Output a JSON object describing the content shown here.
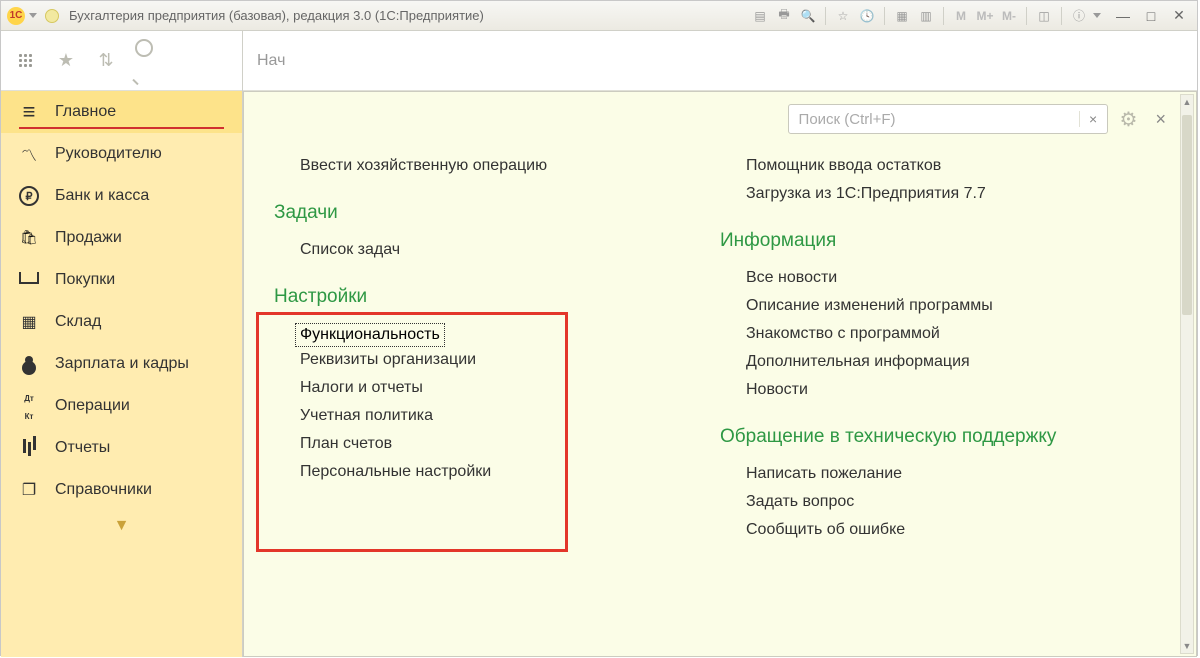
{
  "window": {
    "title": "Бухгалтерия предприятия (базовая), редакция 3.0  (1С:Предприятие)"
  },
  "titlebar_buttons": {
    "m": "M",
    "mplus": "M+",
    "mminus": "M-"
  },
  "tabbar": {
    "partial": "Нач"
  },
  "search": {
    "placeholder": "Поиск (Ctrl+F)",
    "clear": "×"
  },
  "sidebar": {
    "items": [
      {
        "label": "Главное",
        "icon": "menu",
        "active": true
      },
      {
        "label": "Руководителю",
        "icon": "chart"
      },
      {
        "label": "Банк и касса",
        "icon": "ruble"
      },
      {
        "label": "Продажи",
        "icon": "bag"
      },
      {
        "label": "Покупки",
        "icon": "cart"
      },
      {
        "label": "Склад",
        "icon": "boxes"
      },
      {
        "label": "Зарплата и кадры",
        "icon": "person"
      },
      {
        "label": "Операции",
        "icon": "dtkt"
      },
      {
        "label": "Отчеты",
        "icon": "bars"
      },
      {
        "label": "Справочники",
        "icon": "books"
      }
    ]
  },
  "left_col": {
    "link_top": "Ввести хозяйственную операцию",
    "sec_tasks": "Задачи",
    "link_tasks": "Список задач",
    "sec_settings": "Настройки",
    "settings_links": [
      "Функциональность",
      "Реквизиты организации",
      "Налоги и отчеты",
      "Учетная политика",
      "План счетов",
      "Персональные настройки"
    ]
  },
  "right_col": {
    "links_top": [
      "Помощник ввода остатков",
      "Загрузка из 1С:Предприятия 7.7"
    ],
    "sec_info": "Информация",
    "info_links": [
      "Все новости",
      "Описание изменений программы",
      "Знакомство с программой",
      "Дополнительная информация",
      "Новости"
    ],
    "sec_support": "Обращение в техническую поддержку",
    "support_links": [
      "Написать пожелание",
      "Задать вопрос",
      "Сообщить об ошибке"
    ]
  }
}
